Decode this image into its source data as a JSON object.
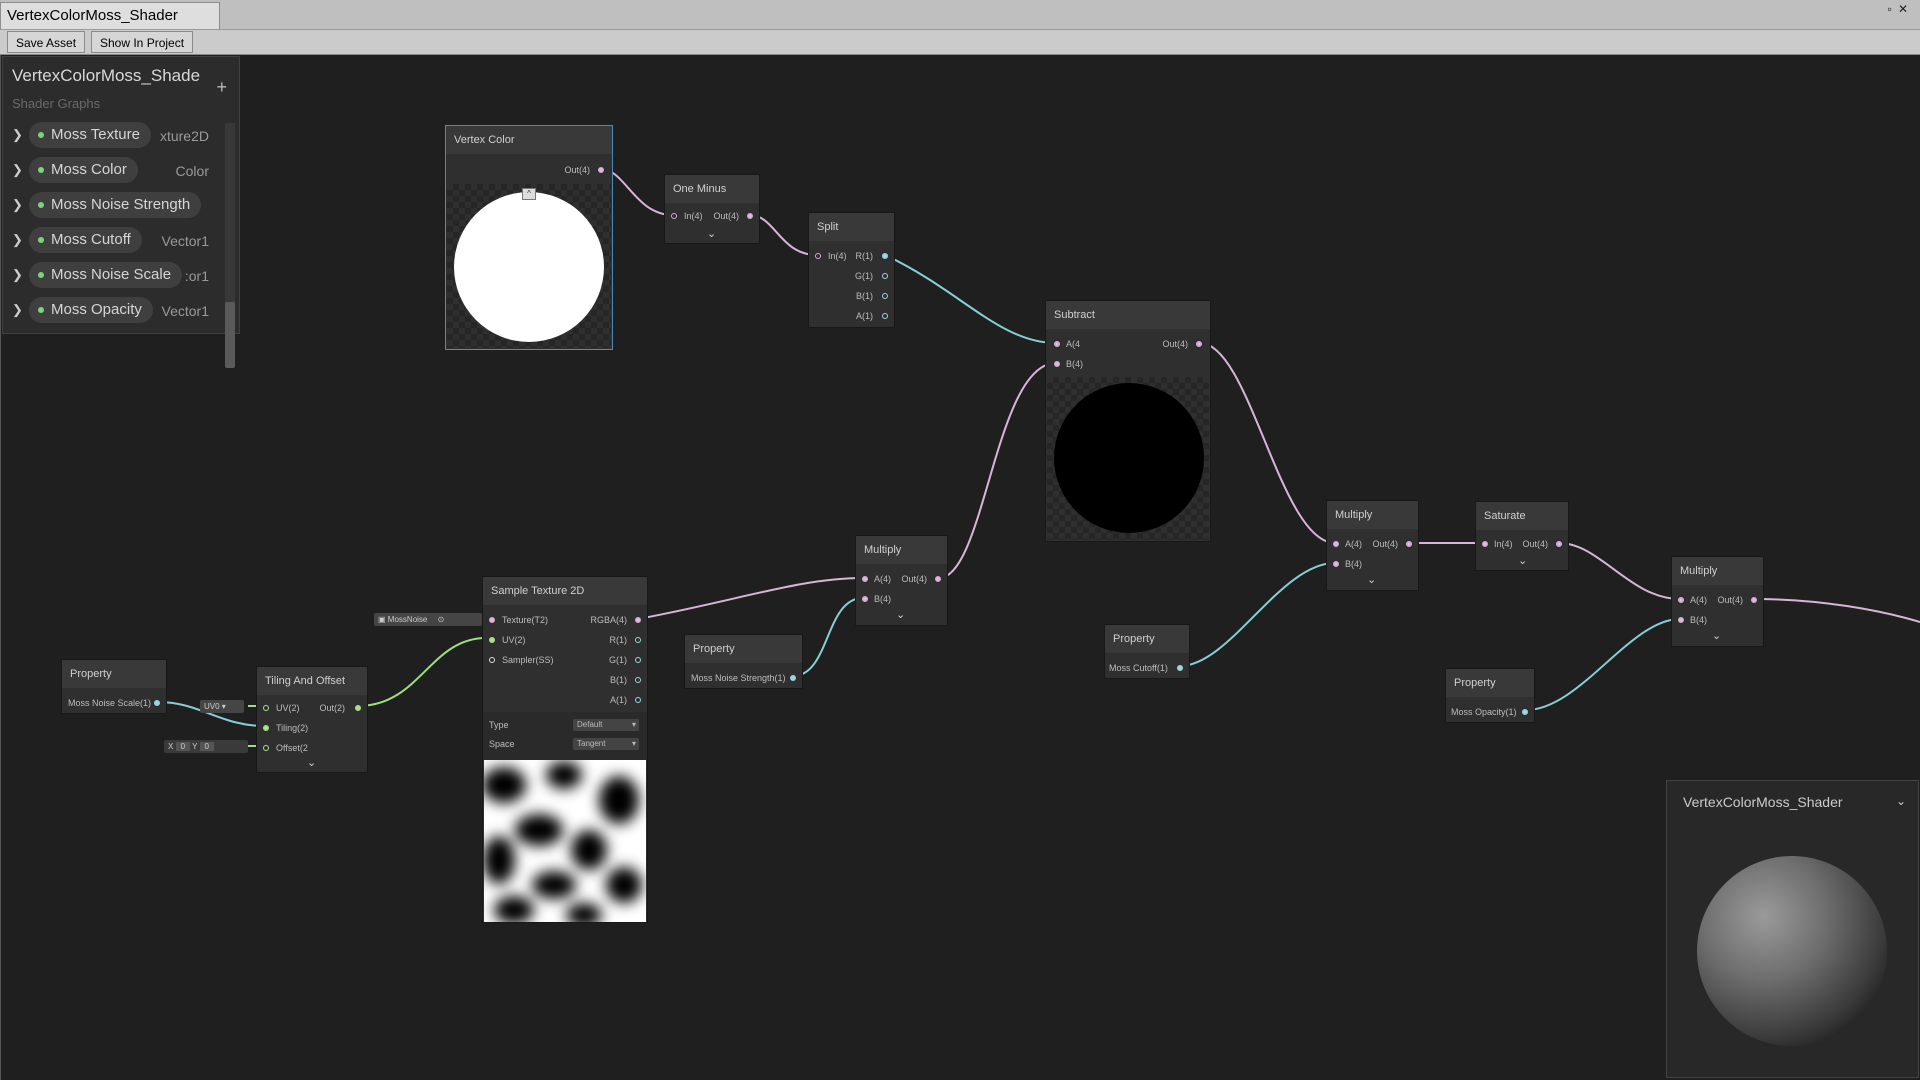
{
  "window": {
    "tab_title": "VertexColorMoss_Shader"
  },
  "toolbar": {
    "save_asset": "Save Asset",
    "show_in_project": "Show In Project"
  },
  "blackboard": {
    "title": "VertexColorMoss_Shade",
    "subtitle": "Shader Graphs",
    "add": "+",
    "properties": [
      {
        "name": "Moss Texture",
        "type": "xture2D"
      },
      {
        "name": "Moss Color",
        "type": "Color"
      },
      {
        "name": "Moss Noise Strength",
        "type": ""
      },
      {
        "name": "Moss Cutoff",
        "type": "Vector1"
      },
      {
        "name": "Moss Noise Scale",
        "type": ":or1"
      },
      {
        "name": "Moss Opacity",
        "type": "Vector1"
      }
    ]
  },
  "nodes": {
    "vertex_color": {
      "title": "Vertex Color",
      "out": "Out(4)"
    },
    "one_minus": {
      "title": "One Minus",
      "in": "In(4)",
      "out": "Out(4)"
    },
    "split": {
      "title": "Split",
      "in": "In(4)",
      "r": "R(1)",
      "g": "G(1)",
      "b": "B(1)",
      "a": "A(1)"
    },
    "subtract": {
      "title": "Subtract",
      "a": "A(4",
      "b": "B(4)",
      "out": "Out(4)"
    },
    "multiply1": {
      "title": "Multiply",
      "a": "A(4)",
      "b": "B(4)",
      "out": "Out(4)"
    },
    "multiply2": {
      "title": "Multiply",
      "a": "A(4)",
      "b": "B(4)",
      "out": "Out(4)"
    },
    "multiply3": {
      "title": "Multiply",
      "a": "A(4)",
      "b": "B(4)",
      "out": "Out(4)"
    },
    "saturate": {
      "title": "Saturate",
      "in": "In(4)",
      "out": "Out(4)"
    },
    "sample_texture": {
      "title": "Sample Texture 2D",
      "texture": "Texture(T2)",
      "uv": "UV(2)",
      "sampler": "Sampler(SS)",
      "rgba": "RGBA(4)",
      "r": "R(1)",
      "g": "G(1)",
      "b": "B(1)",
      "a": "A(1)",
      "type_label": "Type",
      "type_value": "Default",
      "space_label": "Space",
      "space_value": "Tangent",
      "texture_input": "MossNoise"
    },
    "tiling_offset": {
      "title": "Tiling And Offset",
      "uv": "UV(2)",
      "tiling": "Tiling(2)",
      "offset": "Offset(2",
      "out": "Out(2)",
      "uv_input": "UV0",
      "x_label": "X",
      "x_value": "0",
      "y_label": "Y",
      "y_value": "0"
    },
    "prop_noise_scale": {
      "title": "Property",
      "label": "Moss Noise Scale(1)"
    },
    "prop_noise_strength": {
      "title": "Property",
      "label": "Moss Noise Strength(1)"
    },
    "prop_cutoff": {
      "title": "Property",
      "label": "Moss Cutoff(1)"
    },
    "prop_opacity": {
      "title": "Property",
      "label": "Moss Opacity(1)"
    }
  },
  "main_preview": {
    "title": "VertexColorMoss_Shader"
  },
  "wire_colors": {
    "vector4": "#d9b3d9",
    "vector1": "#86cfd9",
    "vector2": "#9be07f"
  }
}
